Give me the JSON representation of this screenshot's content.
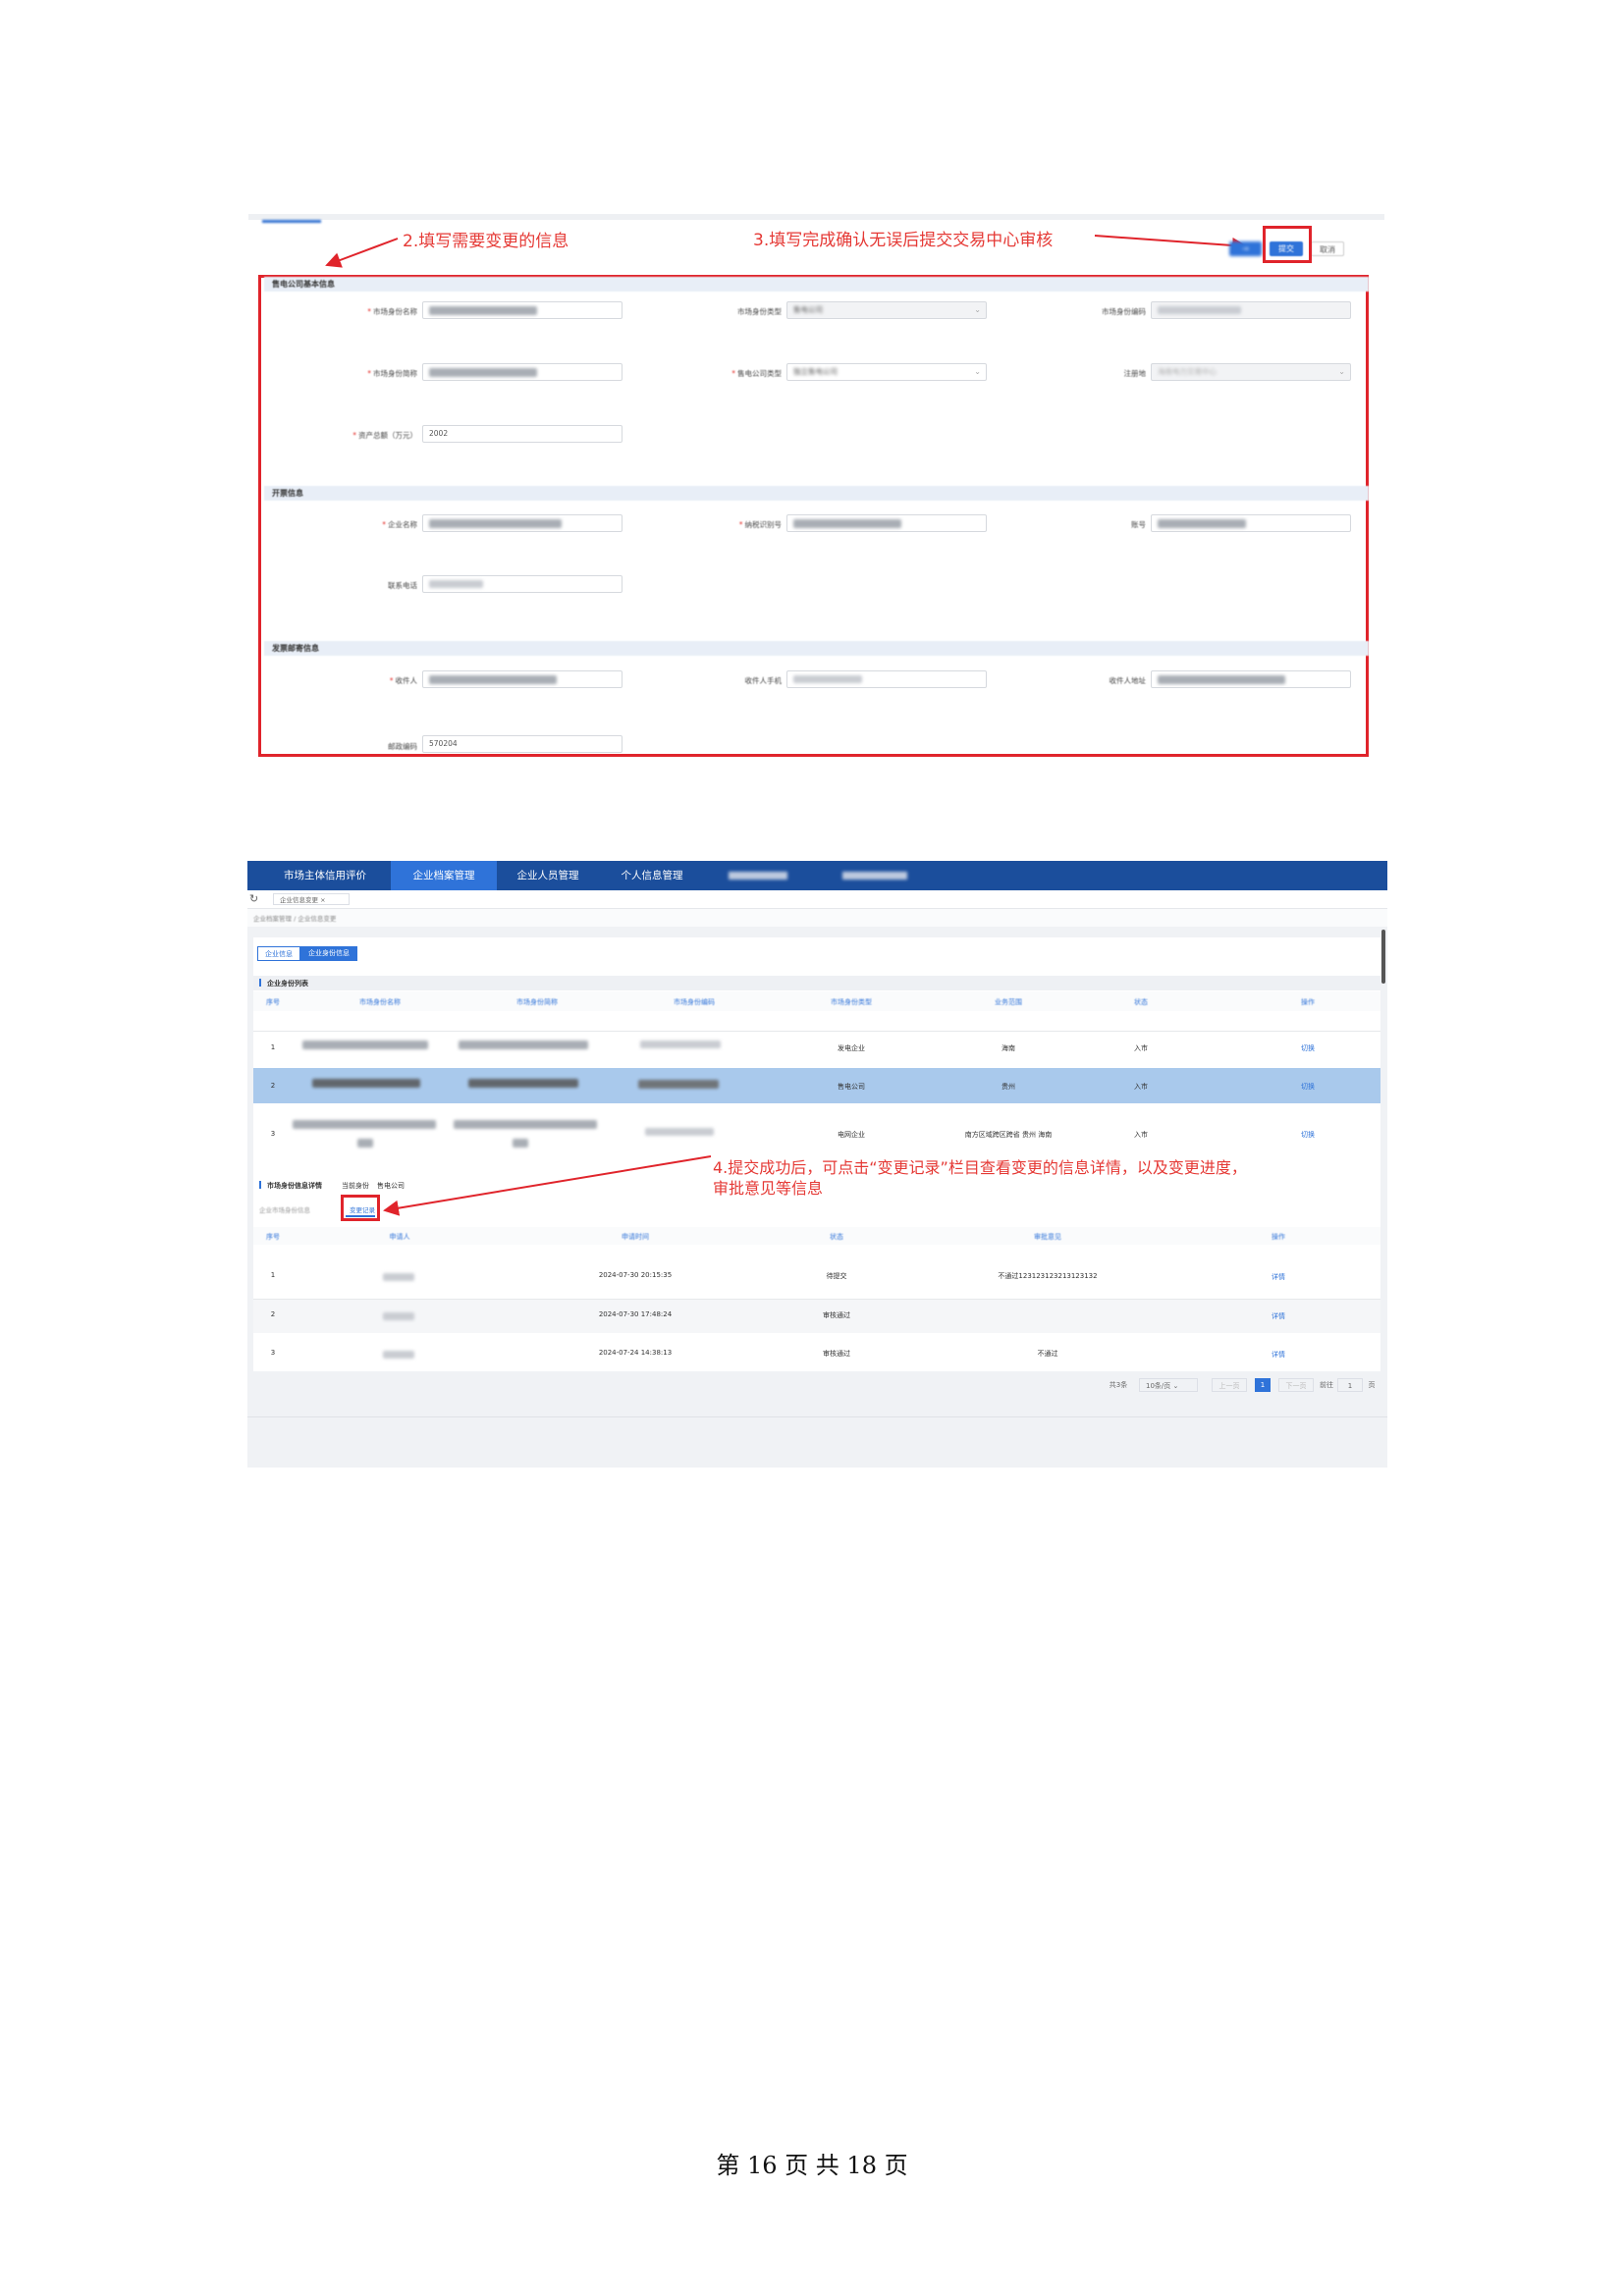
{
  "shot1": {
    "annotations": {
      "step2": "2.填写需要变更的信息",
      "step3": "3.填写完成确认无误后提交交易中心审核"
    },
    "buttons": {
      "submit": "提交",
      "cancel": "取消"
    },
    "section1": {
      "title": "售电公司基本信息",
      "row1": {
        "name_label": "市场身份名称",
        "type_label": "市场身份类型",
        "type_value": "售电公司",
        "code_label": "市场身份编码"
      },
      "row2": {
        "abbr_label": "市场身份简称",
        "company_type_label": "售电公司类型",
        "company_type_value": "独立售电公司",
        "reg_label": "注册地",
        "reg_value": "海南电力交易中心"
      },
      "row3": {
        "asset_label": "资产总额（万元）",
        "asset_value": "2002"
      }
    },
    "section2": {
      "title": "开票信息",
      "company_label": "企业名称",
      "tax_label": "纳税识别号",
      "account_label": "账号",
      "phone_label": "联系电话"
    },
    "section3": {
      "title": "发票邮寄信息",
      "recipient_label": "收件人",
      "recipient_phone_label": "收件人手机",
      "address_label": "收件人地址",
      "postcode_label": "邮政编码",
      "postcode_value": "570204"
    }
  },
  "shot2": {
    "nav": [
      "市场主体信用评价",
      "企业档案管理",
      "企业人员管理",
      "个人信息管理"
    ],
    "nav_active": 1,
    "tab_label": "企业信息变更",
    "breadcrumb": "企业档案管理 / 企业信息变更",
    "seg_tabs": [
      "企业信息",
      "企业身份信息"
    ],
    "list_title": "企业身份列表",
    "list_headers": [
      "序号",
      "市场身份名称",
      "市场身份简称",
      "市场身份编码",
      "市场身份类型",
      "业务范围",
      "状态",
      "操作"
    ],
    "list_rows": [
      {
        "no": "1",
        "type": "发电企业",
        "scope": "海南",
        "status": "入市",
        "op": "切换"
      },
      {
        "no": "2",
        "type": "售电公司",
        "scope": "贵州",
        "status": "入市",
        "op": "切换"
      },
      {
        "no": "3",
        "type": "电网企业",
        "scope": "南方区域跨区跨省 贵州 海南",
        "status": "入市",
        "op": "切换"
      }
    ],
    "detail_title": "市场身份信息详情",
    "current_identity_label": "当前身份",
    "current_identity_value": "售电公司",
    "sub_tabs": [
      "企业市场身份信息",
      "变更记录"
    ],
    "annotation4": [
      "4.提交成功后，可点击“变更记录”栏目查看变更的信息详情，以及变更进度，",
      "审批意见等信息"
    ],
    "record_headers": [
      "序号",
      "申请人",
      "申请时间",
      "状态",
      "审批意见",
      "操作"
    ],
    "record_rows": [
      {
        "no": "1",
        "time": "2024-07-30 20:15:35",
        "status": "待提交",
        "opinion": "不通过123123123213123132",
        "op": "详情"
      },
      {
        "no": "2",
        "time": "2024-07-30 17:48:24",
        "status": "审核通过",
        "opinion": "",
        "op": "详情"
      },
      {
        "no": "3",
        "time": "2024-07-24 14:38:13",
        "status": "审核通过",
        "opinion": "不通过",
        "op": "详情"
      }
    ],
    "pagination": {
      "total": "共3条",
      "page_size": "10条/页",
      "prev": "上一页",
      "current": "1",
      "next": "下一页",
      "goto_label": "前往",
      "goto_value": "1",
      "page_suffix": "页"
    }
  },
  "footer": "第 16 页 共 18 页",
  "colors": {
    "annotation_red": "#e53935",
    "primary_blue": "#2f73d9",
    "nav_blue": "#1b4e9c"
  }
}
